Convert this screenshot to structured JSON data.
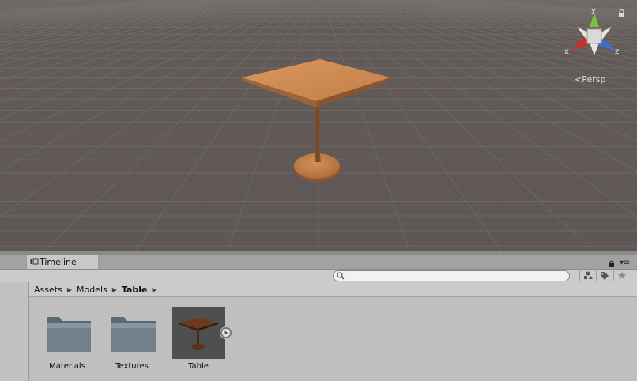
{
  "scene": {
    "camera_label": "Persp",
    "gizmo_axes": {
      "x": "x",
      "y": "y",
      "z": "z"
    },
    "axis_colors": {
      "x": "#c9302c",
      "y": "#7bc043",
      "z": "#3a6fd8"
    }
  },
  "timeline": {
    "tab_label": "Timeline"
  },
  "project": {
    "search": {
      "value": "",
      "placeholder": ""
    },
    "breadcrumb": [
      "Assets",
      "Models",
      "Table"
    ],
    "assets": [
      {
        "name": "Materials",
        "type": "folder"
      },
      {
        "name": "Textures",
        "type": "folder"
      },
      {
        "name": "Table",
        "type": "model"
      }
    ]
  }
}
